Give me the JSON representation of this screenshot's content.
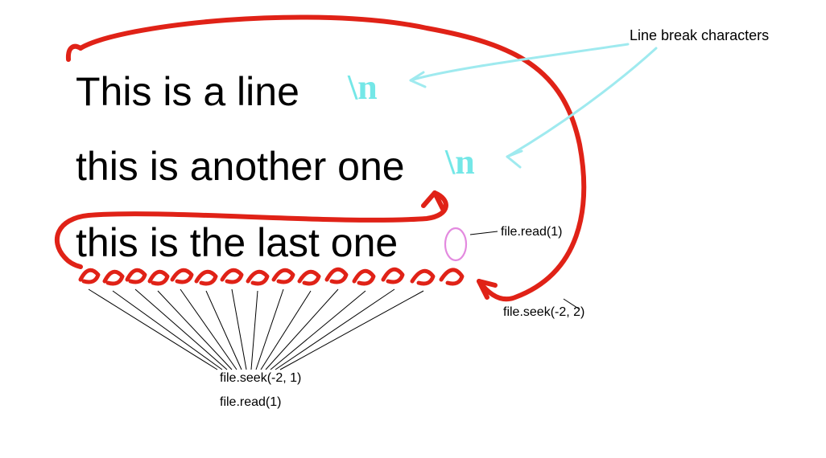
{
  "lines": {
    "l1": "This is a line",
    "l2": "this is another one",
    "l3": "this is the last one"
  },
  "newline_glyph": "\\n",
  "labels": {
    "linebreak": "Line break characters",
    "read1": "file.read(1)",
    "seek_end": "file.seek(-2, 2)",
    "seek_cur": "file.seek(-2, 1)",
    "read1_b": "file.read(1)"
  }
}
